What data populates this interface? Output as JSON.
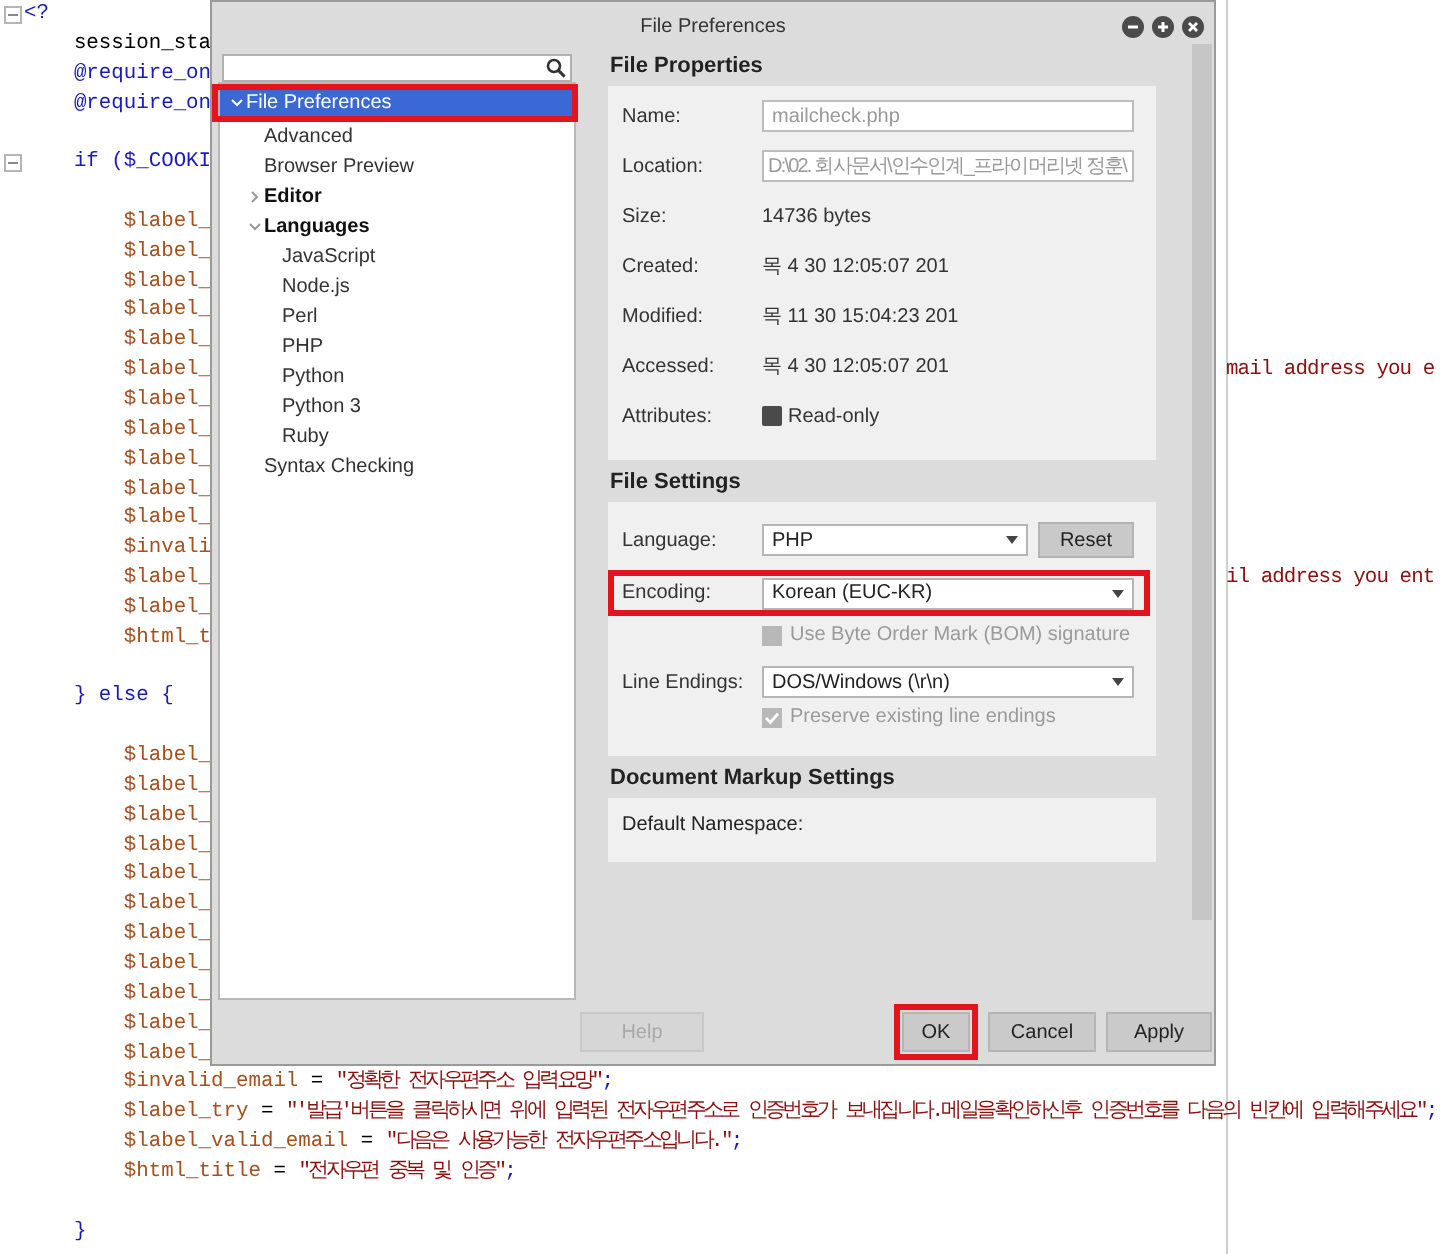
{
  "editor": {
    "lines": [
      {
        "kind": "code",
        "fold": true,
        "segments": [
          {
            "text": "<?",
            "kind": "keyword"
          }
        ],
        "children": [
          {
            "kind": "code",
            "segments": [
              {
                "text": "session_sta",
                "kind": "plain"
              }
            ]
          },
          {
            "kind": "code",
            "segments": [
              {
                "text": "@require_on",
                "kind": "keyword"
              }
            ]
          },
          {
            "kind": "code",
            "segments": [
              {
                "text": "@require_on",
                "kind": "keyword"
              }
            ]
          },
          {
            "kind": "blank"
          },
          {
            "kind": "code",
            "fold": true,
            "segments": [
              {
                "text": "if ($_COOKI",
                "kind": "keyword"
              }
            ],
            "children": [
              {
                "kind": "blank"
              },
              {
                "kind": "code",
                "segments": [
                  {
                    "text": "$label_",
                    "kind": "variable"
                  }
                ]
              },
              {
                "kind": "code",
                "segments": [
                  {
                    "text": "$label_",
                    "kind": "variable"
                  }
                ]
              },
              {
                "kind": "code",
                "segments": [
                  {
                    "text": "$label_",
                    "kind": "variable"
                  }
                ]
              },
              {
                "kind": "code",
                "segments": [
                  {
                    "text": "$label_",
                    "kind": "variable"
                  }
                ]
              },
              {
                "kind": "code",
                "segments": [
                  {
                    "text": "$label_",
                    "kind": "variable"
                  }
                ]
              },
              {
                "kind": "code",
                "segments": [
                  {
                    "text": "$label_",
                    "kind": "variable"
                  }
                ],
                "tail": [
                  {
                    "text": "mail address you e",
                    "kind": "string"
                  }
                ]
              },
              {
                "kind": "code",
                "segments": [
                  {
                    "text": "$label_",
                    "kind": "variable"
                  }
                ]
              },
              {
                "kind": "code",
                "segments": [
                  {
                    "text": "$label_",
                    "kind": "variable"
                  }
                ]
              },
              {
                "kind": "code",
                "segments": [
                  {
                    "text": "$label_",
                    "kind": "variable"
                  }
                ]
              },
              {
                "kind": "code",
                "segments": [
                  {
                    "text": "$label_",
                    "kind": "variable"
                  }
                ]
              },
              {
                "kind": "code",
                "segments": [
                  {
                    "text": "$label_",
                    "kind": "variable"
                  }
                ]
              },
              {
                "kind": "code",
                "segments": [
                  {
                    "text": "$invali",
                    "kind": "variable"
                  }
                ]
              },
              {
                "kind": "code",
                "segments": [
                  {
                    "text": "$label_",
                    "kind": "variable"
                  }
                ],
                "tail": [
                  {
                    "text": "il address you ent",
                    "kind": "string"
                  }
                ]
              },
              {
                "kind": "code",
                "segments": [
                  {
                    "text": "$label_",
                    "kind": "variable"
                  }
                ]
              },
              {
                "kind": "code",
                "segments": [
                  {
                    "text": "$html_t",
                    "kind": "variable"
                  }
                ]
              },
              {
                "kind": "blank"
              }
            ]
          },
          {
            "kind": "code",
            "segments": [
              {
                "text": "} else {",
                "kind": "keyword"
              }
            ],
            "children": [
              {
                "kind": "blank"
              },
              {
                "kind": "code",
                "segments": [
                  {
                    "text": "$label_",
                    "kind": "variable"
                  }
                ]
              },
              {
                "kind": "code",
                "segments": [
                  {
                    "text": "$label_",
                    "kind": "variable"
                  }
                ]
              },
              {
                "kind": "code",
                "segments": [
                  {
                    "text": "$label_",
                    "kind": "variable"
                  }
                ]
              },
              {
                "kind": "code",
                "segments": [
                  {
                    "text": "$label_",
                    "kind": "variable"
                  }
                ]
              },
              {
                "kind": "code",
                "segments": [
                  {
                    "text": "$label_",
                    "kind": "variable"
                  }
                ]
              },
              {
                "kind": "code",
                "segments": [
                  {
                    "text": "$label_",
                    "kind": "variable"
                  }
                ]
              },
              {
                "kind": "code",
                "segments": [
                  {
                    "text": "$label_",
                    "kind": "variable"
                  }
                ]
              },
              {
                "kind": "code",
                "segments": [
                  {
                    "text": "$label_",
                    "kind": "variable"
                  }
                ]
              },
              {
                "kind": "code",
                "segments": [
                  {
                    "text": "$label_",
                    "kind": "variable"
                  }
                ]
              },
              {
                "kind": "code",
                "segments": [
                  {
                    "text": "$label_",
                    "kind": "variable"
                  }
                ]
              },
              {
                "kind": "code",
                "segments": [
                  {
                    "text": "$label_",
                    "kind": "variable"
                  }
                ]
              },
              {
                "kind": "code",
                "segments": [
                  {
                    "text": "$invalid_email",
                    "kind": "variable"
                  },
                  {
                    "text": " = ",
                    "kind": "plain"
                  },
                  {
                    "text": "\"정확한 전자우편주소 입력요망\"",
                    "kind": "string"
                  },
                  {
                    "text": ";",
                    "kind": "keyword"
                  }
                ]
              },
              {
                "kind": "code",
                "segments": [
                  {
                    "text": "$label_try",
                    "kind": "variable"
                  },
                  {
                    "text": " = ",
                    "kind": "plain"
                  },
                  {
                    "text": "\"'발급'버튼을 클릭하시면 위에 입력된 전자우편주소로 인증번호가 보내집니다.메일을확인하신후 인증번호를 다음의 빈칸에 입력해주세요\"",
                    "kind": "string"
                  },
                  {
                    "text": ";",
                    "kind": "keyword"
                  }
                ]
              },
              {
                "kind": "code",
                "segments": [
                  {
                    "text": "$label_valid_email",
                    "kind": "variable"
                  },
                  {
                    "text": " = ",
                    "kind": "plain"
                  },
                  {
                    "text": "\"다음은 사용가능한 전자우편주소입니다.\"",
                    "kind": "string"
                  },
                  {
                    "text": ";",
                    "kind": "keyword"
                  }
                ]
              },
              {
                "kind": "code",
                "segments": [
                  {
                    "text": "$html_title",
                    "kind": "variable"
                  },
                  {
                    "text": " = ",
                    "kind": "plain"
                  },
                  {
                    "text": "\"전자우편 중복 및 인증\"",
                    "kind": "string"
                  },
                  {
                    "text": ";",
                    "kind": "keyword"
                  }
                ]
              },
              {
                "kind": "blank"
              }
            ]
          },
          {
            "kind": "code",
            "segments": [
              {
                "text": "}",
                "kind": "keyword"
              }
            ]
          }
        ]
      }
    ]
  },
  "dialog": {
    "title": "File Preferences",
    "tree": [
      {
        "label": "File Preferences",
        "selected": true,
        "highlighted": true,
        "expanded": true,
        "children": [
          {
            "label": "Advanced",
            "selected": false,
            "highlighted": false
          },
          {
            "label": "Browser Preview",
            "selected": false,
            "highlighted": false
          },
          {
            "label": "Editor",
            "selected": false,
            "highlighted": false,
            "expanded": false
          },
          {
            "label": "Languages",
            "selected": false,
            "highlighted": false,
            "expanded": true,
            "children": [
              {
                "label": "JavaScript",
                "selected": false,
                "highlighted": false
              },
              {
                "label": "Node.js",
                "selected": false,
                "highlighted": false
              },
              {
                "label": "Perl",
                "selected": false,
                "highlighted": false
              },
              {
                "label": "PHP",
                "selected": false,
                "highlighted": false
              },
              {
                "label": "Python",
                "selected": false,
                "highlighted": false
              },
              {
                "label": "Python 3",
                "selected": false,
                "highlighted": false
              },
              {
                "label": "Ruby",
                "selected": false,
                "highlighted": false
              }
            ]
          },
          {
            "label": "Syntax Checking",
            "selected": false,
            "highlighted": false
          }
        ]
      }
    ],
    "sections": [
      {
        "title": "File Properties",
        "kind": "properties",
        "rows": [
          {
            "kind": "field",
            "label": "Name:",
            "value": "mailcheck.php"
          },
          {
            "kind": "field",
            "label": "Location:",
            "value": "D:\\02. 회사문서\\인수인계_프라이머리넷 정훈\\"
          },
          {
            "kind": "text",
            "label": "Size:",
            "value": "14736 bytes"
          },
          {
            "kind": "text",
            "label": "Created:",
            "value": "목 4 30 12:05:07 201"
          },
          {
            "kind": "text",
            "label": "Modified:",
            "value": "목 11 30 15:04:23 201"
          },
          {
            "kind": "text",
            "label": "Accessed:",
            "value": "목 4 30 12:05:07 201"
          },
          {
            "kind": "checkbox",
            "label": "Attributes:",
            "text": "Read-only",
            "checked": false,
            "disabled": false
          }
        ]
      },
      {
        "title": "File Settings",
        "kind": "settings",
        "rows": [
          {
            "kind": "dropdown",
            "label": "Language:",
            "value": "PHP",
            "button": "Reset",
            "highlighted": false
          },
          {
            "kind": "dropdown",
            "label": "Encoding:",
            "value": "Korean (EUC-KR)",
            "highlighted": true
          },
          {
            "kind": "option",
            "text": "Use Byte Order Mark (BOM) signature",
            "checked": false,
            "disabled": true
          },
          {
            "kind": "dropdown",
            "label": "Line Endings:",
            "value": "DOS/Windows (\\r\\n)",
            "highlighted": false
          },
          {
            "kind": "option",
            "text": "Preserve existing line endings",
            "checked": true,
            "disabled": true
          }
        ]
      },
      {
        "title": "Document Markup Settings",
        "kind": "markup",
        "rows": [
          {
            "kind": "label",
            "label": "Default Namespace:"
          }
        ]
      }
    ],
    "buttons": [
      {
        "label": "Help",
        "disabled": true,
        "highlighted": false
      },
      {
        "label": "OK",
        "disabled": false,
        "highlighted": true
      },
      {
        "label": "Cancel",
        "disabled": false,
        "highlighted": false
      },
      {
        "label": "Apply",
        "disabled": false,
        "highlighted": false
      }
    ]
  }
}
